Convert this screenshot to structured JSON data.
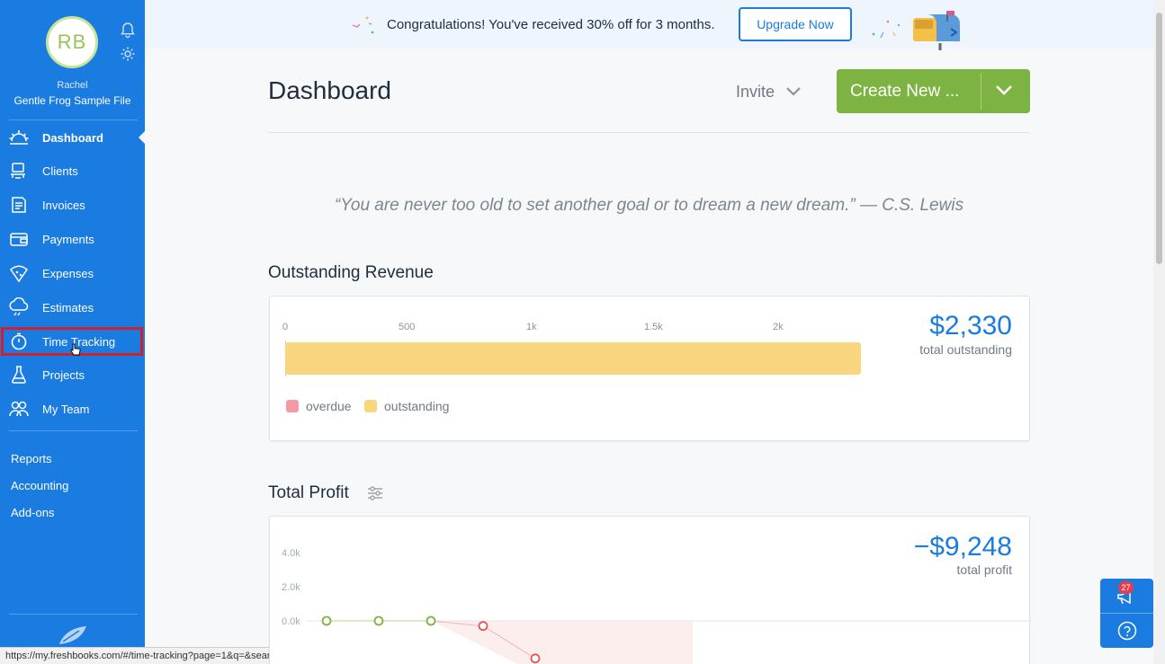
{
  "user": {
    "initials": "RB",
    "name": "Rachel",
    "company": "Gentle Frog Sample File"
  },
  "nav": {
    "items": [
      {
        "label": "Dashboard",
        "icon": "dashboard-icon"
      },
      {
        "label": "Clients",
        "icon": "clients-icon"
      },
      {
        "label": "Invoices",
        "icon": "invoices-icon"
      },
      {
        "label": "Payments",
        "icon": "payments-icon"
      },
      {
        "label": "Expenses",
        "icon": "expenses-icon"
      },
      {
        "label": "Estimates",
        "icon": "estimates-icon"
      },
      {
        "label": "Time Tracking",
        "icon": "stopwatch-icon"
      },
      {
        "label": "Projects",
        "icon": "flask-icon"
      },
      {
        "label": "My Team",
        "icon": "team-icon"
      }
    ],
    "active": "Dashboard",
    "sections": [
      "Reports",
      "Accounting",
      "Add-ons"
    ]
  },
  "banner": {
    "text": "Congratulations! You've received 30% off for 3 months.",
    "button": "Upgrade Now"
  },
  "header": {
    "title": "Dashboard",
    "invite": "Invite",
    "create_new": "Create New ..."
  },
  "quote": "“You are never too old to set another goal or to dream a new dream.” — C.S. Lewis",
  "outstanding": {
    "title": "Outstanding Revenue",
    "amount": "$2,330",
    "amount_label": "total outstanding",
    "ticks": [
      "0",
      "500",
      "1k",
      "1.5k",
      "2k"
    ],
    "legend": [
      "overdue",
      "outstanding"
    ]
  },
  "profit": {
    "title": "Total Profit",
    "amount": "−$9,248",
    "amount_label": "total profit",
    "yticks": [
      "4.0k",
      "2.0k",
      "0.0k"
    ]
  },
  "chart_data": [
    {
      "type": "bar",
      "categories": [
        "total"
      ],
      "series": [
        {
          "name": "overdue",
          "values": [
            0
          ]
        },
        {
          "name": "outstanding",
          "values": [
            2330
          ]
        }
      ],
      "xlim": [
        0,
        2330
      ],
      "orientation": "horizontal"
    },
    {
      "type": "line",
      "x": [
        1,
        2,
        3,
        4,
        5
      ],
      "values": [
        0,
        0,
        0,
        -300,
        -2200
      ],
      "yticks": [
        "4.0k",
        "2.0k",
        "0.0k"
      ],
      "ylim": [
        -2500,
        4000
      ]
    }
  ],
  "floating": {
    "notifications": "27"
  },
  "status_url": "https://my.freshbooks.com/#/time-tracking?page=1&q=&searchDateType=date",
  "colors": {
    "sidebar": "#1a7be0",
    "accent_green": "#7cb342",
    "outstanding": "#f8d57e",
    "overdue": "#f49ba1",
    "link_blue": "#1a7be0"
  }
}
